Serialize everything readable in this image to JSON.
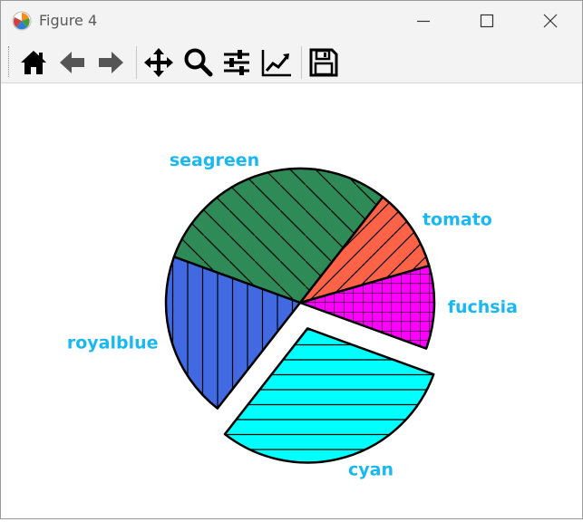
{
  "window": {
    "title": "Figure 4"
  },
  "toolbar": {
    "buttons": [
      {
        "name": "home-icon"
      },
      {
        "name": "back-icon"
      },
      {
        "name": "forward-icon"
      },
      {
        "name": "pan-icon"
      },
      {
        "name": "zoom-icon"
      },
      {
        "name": "configure-subplots-icon"
      },
      {
        "name": "edit-axis-icon"
      },
      {
        "name": "save-icon"
      }
    ]
  },
  "colors": {
    "label": "#1ab8f0"
  },
  "chart_data": {
    "type": "pie",
    "title": "",
    "labels": [
      "royalblue",
      "seagreen",
      "tomato",
      "fuchsia",
      "cyan"
    ],
    "colors": [
      "#4169e1",
      "#2e8b57",
      "#ff6347",
      "#ff00ff",
      "#00ffff"
    ],
    "hatches": [
      "vertical",
      "diagonal",
      "diagonal",
      "grid",
      "horizontal"
    ],
    "values": [
      20,
      30,
      10,
      10,
      30
    ],
    "explode": [
      0,
      0,
      0,
      0,
      0.2
    ],
    "startangle": -20
  }
}
